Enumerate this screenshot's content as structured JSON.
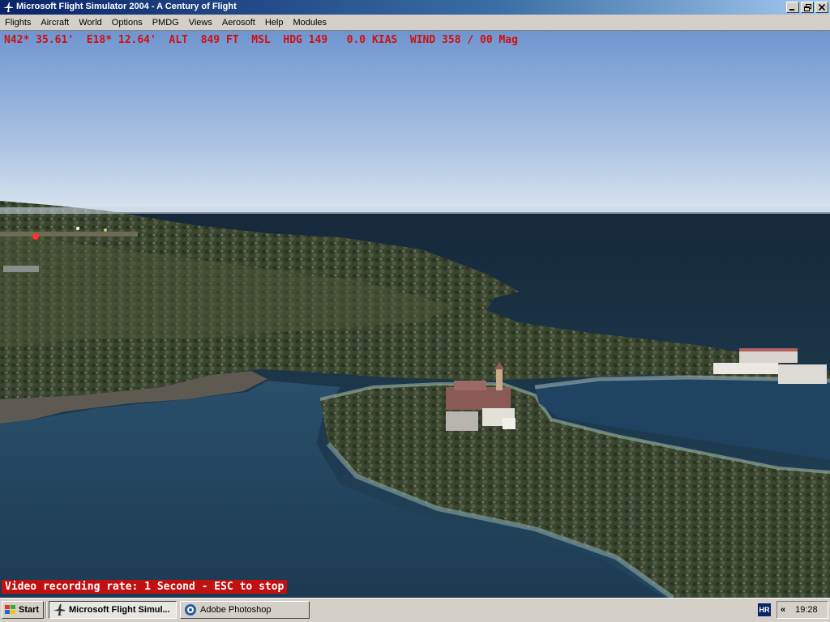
{
  "window": {
    "title": "Microsoft Flight Simulator 2004 - A Century of Flight",
    "controls": [
      "minimize",
      "restore",
      "close"
    ]
  },
  "menu": [
    "Flights",
    "Aircraft",
    "World",
    "Options",
    "PMDG",
    "Views",
    "Aerosoft",
    "Help",
    "Modules"
  ],
  "hud": {
    "text": "N42* 35.61'  E18* 12.64'  ALT  849 FT  MSL  HDG 149   0.0 KIAS  WIND 358 / 00 Mag",
    "color": "#d01010"
  },
  "recording": {
    "text": "Video recording rate: 1 Second - ESC to stop",
    "color": "#c01010"
  },
  "taskbar": {
    "start_label": "Start",
    "tasks": [
      {
        "label": "Microsoft Flight Simul...",
        "active": true
      },
      {
        "label": "Adobe Photoshop",
        "active": false
      }
    ],
    "language": "HR",
    "clock": "19:28"
  },
  "colors": {
    "sky_top": "#6f95cf",
    "sky_horizon": "#dbe6f1",
    "sea": "#1e3a52",
    "land": "#3b4630",
    "titlebar": "#0a246a"
  }
}
